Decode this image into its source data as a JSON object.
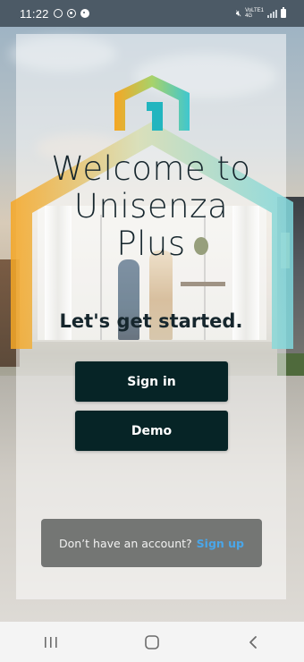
{
  "status_bar": {
    "time": "11:22",
    "network_line1": "VoLTE1",
    "network_line2": "4G",
    "icons": [
      "whatsapp-icon",
      "record-icon",
      "account-icon",
      "mute-icon",
      "signal-icon",
      "battery-icon"
    ]
  },
  "welcome": {
    "title": "Welcome to\nUnisenza\nPlus",
    "subtitle": "Let's get started."
  },
  "buttons": {
    "sign_in": "Sign in",
    "demo": "Demo"
  },
  "signup": {
    "prompt": "Don’t have an account?",
    "link": "Sign up"
  },
  "nav_bar": {
    "icons": [
      "recent-apps-icon",
      "home-icon",
      "back-icon"
    ]
  },
  "colors": {
    "button_bg": "#062426",
    "link": "#4aa6e9",
    "logo_orange": "#f6a623",
    "logo_teal": "#3fc7cf",
    "text_dark": "#16262d"
  }
}
